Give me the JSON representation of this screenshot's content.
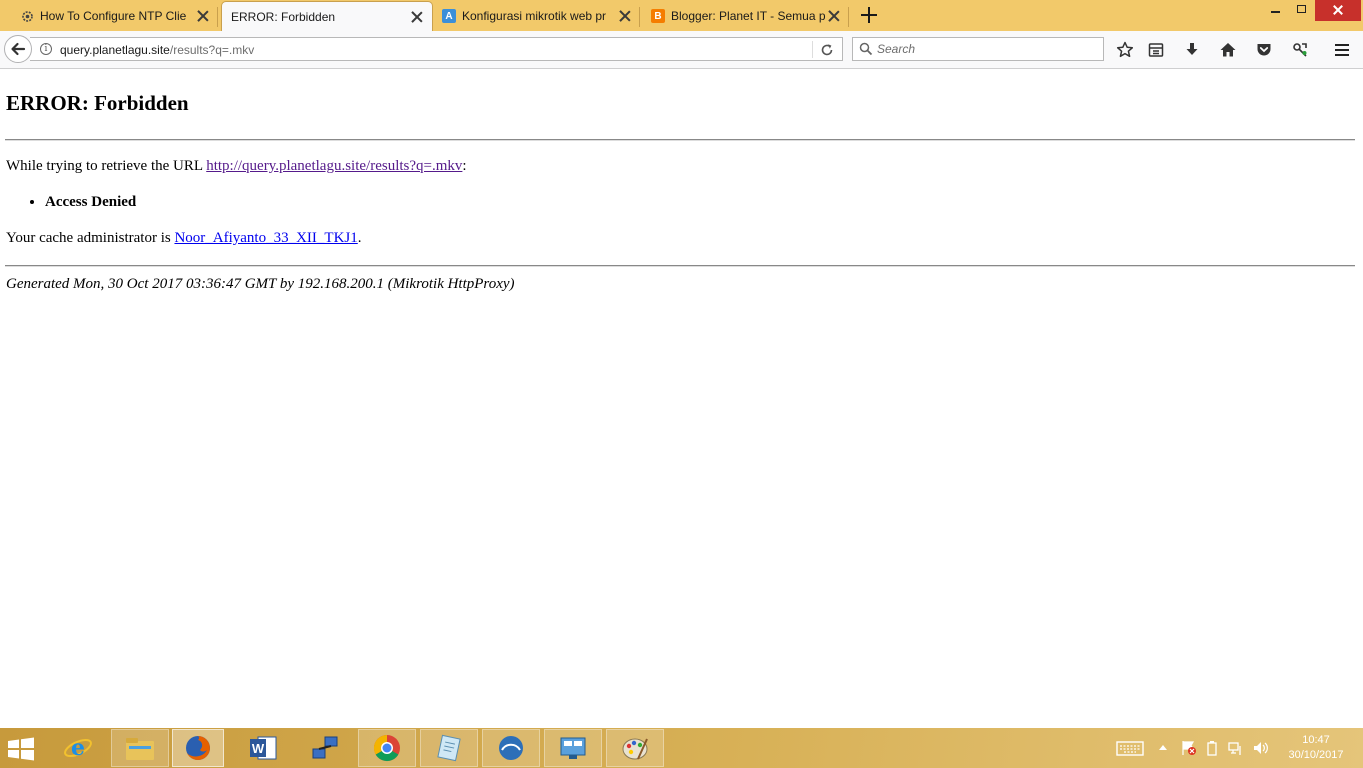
{
  "browser": {
    "tabs": [
      {
        "title": "How To Configure NTP Clie",
        "icon": "gear-icon",
        "active": false
      },
      {
        "title": "ERROR: Forbidden",
        "icon": "",
        "active": true
      },
      {
        "title": "Konfigurasi mikrotik web pr",
        "icon": "letter-a-icon",
        "icon_letter": "A",
        "active": false
      },
      {
        "title": "Blogger: Planet IT - Semua p",
        "icon": "blogger-icon",
        "icon_letter": "B",
        "active": false
      }
    ],
    "url_host": "query.planetlagu.site",
    "url_path": "/results?q=.mkv",
    "search_placeholder": "Search",
    "toolbar_icons": [
      "bookmark-star-icon",
      "reading-list-icon",
      "downloads-icon",
      "home-icon",
      "pocket-icon",
      "extension-icon",
      "menu-icon"
    ]
  },
  "page": {
    "heading": "ERROR: Forbidden",
    "retrieve_prefix": "While trying to retrieve the URL ",
    "retrieve_url": "http://query.planetlagu.site/results?q=.mkv",
    "retrieve_suffix": ":",
    "error_item": "Access Denied",
    "admin_prefix": "Your cache administrator is ",
    "admin_link": "Noor_Afiyanto_33_XII_TKJ1",
    "admin_suffix": ".",
    "generated": "Generated Mon, 30 Oct 2017 03:36:47 GMT by 192.168.200.1 (Mikrotik HttpProxy)"
  },
  "taskbar": {
    "apps": [
      "internet-explorer-icon",
      "file-explorer-icon",
      "firefox-icon",
      "word-icon",
      "network-tool-icon",
      "chrome-icon",
      "notepad-icon",
      "winbox-icon",
      "control-panel-icon",
      "paint-icon"
    ],
    "time": "10:47",
    "date": "30/10/2017",
    "colors": {
      "accent": "#d8b157",
      "close": "#c7302b"
    }
  }
}
